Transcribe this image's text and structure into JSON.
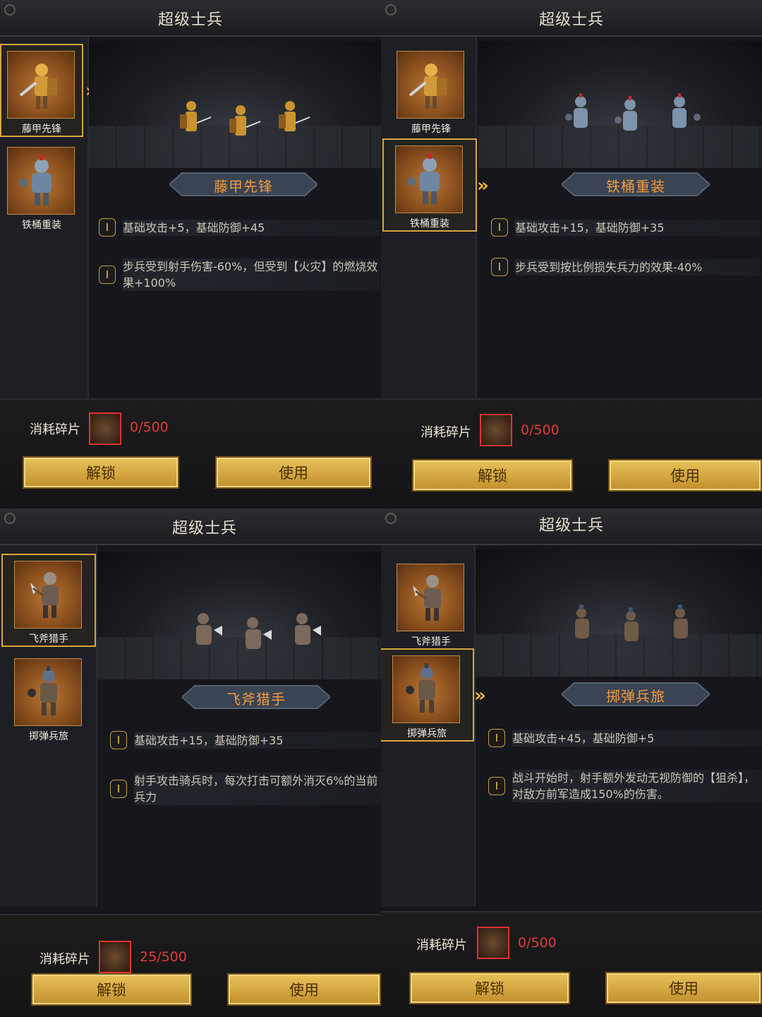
{
  "panels": [
    {
      "title": "超级士兵",
      "units": [
        {
          "label": "藤甲先锋",
          "icon": "rattan-armor-vanguard-icon",
          "selected": true
        },
        {
          "label": "铁桶重装",
          "icon": "iron-bucket-heavy-icon",
          "selected": false
        }
      ],
      "selected_name": "藤甲先锋",
      "effects": [
        "基础攻击+5，基础防御+45",
        "步兵受到射手伤害-60%，但受到【火灾】的燃烧效果+100%"
      ],
      "cost_label": "消耗碎片",
      "cost_value": "0/500",
      "unlock_label": "解锁",
      "use_label": "使用"
    },
    {
      "title": "超级士兵",
      "units": [
        {
          "label": "藤甲先锋",
          "icon": "rattan-armor-vanguard-icon",
          "selected": false
        },
        {
          "label": "铁桶重装",
          "icon": "iron-bucket-heavy-icon",
          "selected": true
        }
      ],
      "selected_name": "铁桶重装",
      "effects": [
        "基础攻击+15，基础防御+35",
        "步兵受到按比例损失兵力的效果-40%"
      ],
      "cost_label": "消耗碎片",
      "cost_value": "0/500",
      "unlock_label": "解锁",
      "use_label": "使用"
    },
    {
      "title": "超级士兵",
      "units": [
        {
          "label": "飞斧猎手",
          "icon": "flying-axe-hunter-icon",
          "selected": true
        },
        {
          "label": "掷弹兵旅",
          "icon": "grenadier-brigade-icon",
          "selected": false
        }
      ],
      "selected_name": "飞斧猎手",
      "effects": [
        "基础攻击+15，基础防御+35",
        "射手攻击骑兵时，每次打击可额外消灭6%的当前兵力"
      ],
      "cost_label": "消耗碎片",
      "cost_value": "25/500",
      "unlock_label": "解锁",
      "use_label": "使用"
    },
    {
      "title": "超级士兵",
      "units": [
        {
          "label": "飞斧猎手",
          "icon": "flying-axe-hunter-icon",
          "selected": false
        },
        {
          "label": "掷弹兵旅",
          "icon": "grenadier-brigade-icon",
          "selected": true
        }
      ],
      "selected_name": "掷弹兵旅",
      "effects": [
        "基础攻击+45，基础防御+5",
        "战斗开始时，射手额外发动无视防御的【狙杀】，对敌方前军造成150%的伤害。"
      ],
      "cost_label": "消耗碎片",
      "cost_value": "0/500",
      "unlock_label": "解锁",
      "use_label": "使用"
    }
  ],
  "colors": {
    "accent_gold": "#d6a640",
    "name_orange": "#f09a3e",
    "cost_red": "#e23b3b"
  }
}
